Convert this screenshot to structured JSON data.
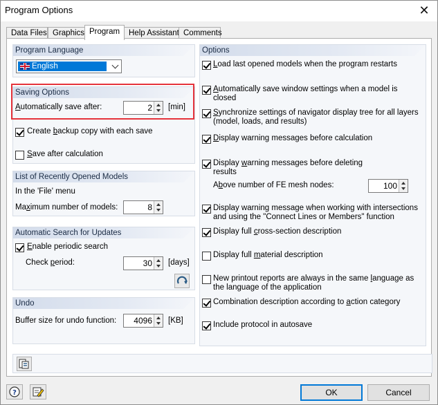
{
  "window": {
    "title": "Program Options",
    "close_glyph": "✕"
  },
  "tabs": [
    {
      "label": "Data Files",
      "active": false
    },
    {
      "label": "Graphics",
      "active": false
    },
    {
      "label": "Program",
      "active": true
    },
    {
      "label": "Help Assistant",
      "active": false
    },
    {
      "label": "Comments",
      "active": false
    }
  ],
  "program_language": {
    "header": "Program Language",
    "selected": "English",
    "flag_icon": "uk-flag-icon"
  },
  "saving_options": {
    "header": "Saving Options",
    "autosave_label_pre": "",
    "autosave_label_u": "A",
    "autosave_label_post": "utomatically save after:",
    "autosave_value": "2",
    "autosave_unit": "[min]",
    "backup_label_pre": "Create ",
    "backup_label_u": "b",
    "backup_label_post": "ackup copy with each save",
    "backup_checked": true,
    "save_after_calc_label_pre": "",
    "save_after_calc_label_u": "S",
    "save_after_calc_label_post": "ave after calculation",
    "save_after_calc_checked": false
  },
  "recent_models": {
    "header": "List of Recently Opened Models",
    "file_menu_label": "In the 'File' menu",
    "max_label_pre": "Ma",
    "max_label_u": "x",
    "max_label_post": "imum number of models:",
    "max_value": "8"
  },
  "updates": {
    "header": "Automatic Search for Updates",
    "enable_label_pre": "",
    "enable_label_u": "E",
    "enable_label_post": "nable periodic search",
    "enable_checked": true,
    "period_label_pre": "Check ",
    "period_label_u": "p",
    "period_label_post": "eriod:",
    "period_value": "30",
    "period_unit": "[days]",
    "refresh_icon": "refresh-icon"
  },
  "undo": {
    "header": "Undo",
    "buffer_label": "Buffer size for undo function:",
    "buffer_value": "4096",
    "buffer_unit": "[KB]"
  },
  "options": {
    "header": "Options",
    "items": [
      {
        "pre": "",
        "u": "L",
        "post": "oad last opened models when the program restarts",
        "line2": "",
        "checked": true
      },
      {
        "pre": "",
        "u": "A",
        "post": "utomatically save window settings when a model is",
        "line2": "closed",
        "checked": true
      },
      {
        "pre": "",
        "u": "S",
        "post": "ynchronize settings of navigator display tree for all layers",
        "line2": "(model, loads, and results)",
        "checked": true
      },
      {
        "pre": "",
        "u": "D",
        "post": "isplay warning messages before calculation",
        "line2": "",
        "checked": true
      },
      {
        "pre": "Display ",
        "u": "w",
        "post": "arning messages before deleting",
        "line2": "results",
        "checked": true
      },
      {
        "pre": "Display warning message when working with intersections",
        "u": "",
        "post": "",
        "line2": "and using the \"Connect Lines or Members\" function",
        "checked": true
      },
      {
        "pre": "Display full ",
        "u": "c",
        "post": "ross-section description",
        "line2": "",
        "checked": true
      },
      {
        "pre": "Display full ",
        "u": "m",
        "post": "aterial description",
        "line2": "",
        "checked": false
      },
      {
        "pre": "New printout reports are always in the same ",
        "u": "l",
        "post": "anguage as",
        "line2": "the language of the application",
        "checked": false
      },
      {
        "pre": "Combination description according to ",
        "u": "a",
        "post": "ction category",
        "line2": "",
        "checked": true
      },
      {
        "pre": "Include protocol in autosave",
        "u": "",
        "post": "",
        "line2": "",
        "checked": true
      }
    ],
    "fe_nodes_label_pre": "A",
    "fe_nodes_label_u": "b",
    "fe_nodes_label_post": "ove number of FE mesh nodes:",
    "fe_nodes_value": "100"
  },
  "footer": {
    "ok_label": "OK",
    "cancel_label": "Cancel",
    "help_icon": "help-icon",
    "edit_icon": "edit-icon",
    "defaults_icon": "default-settings-icon"
  }
}
